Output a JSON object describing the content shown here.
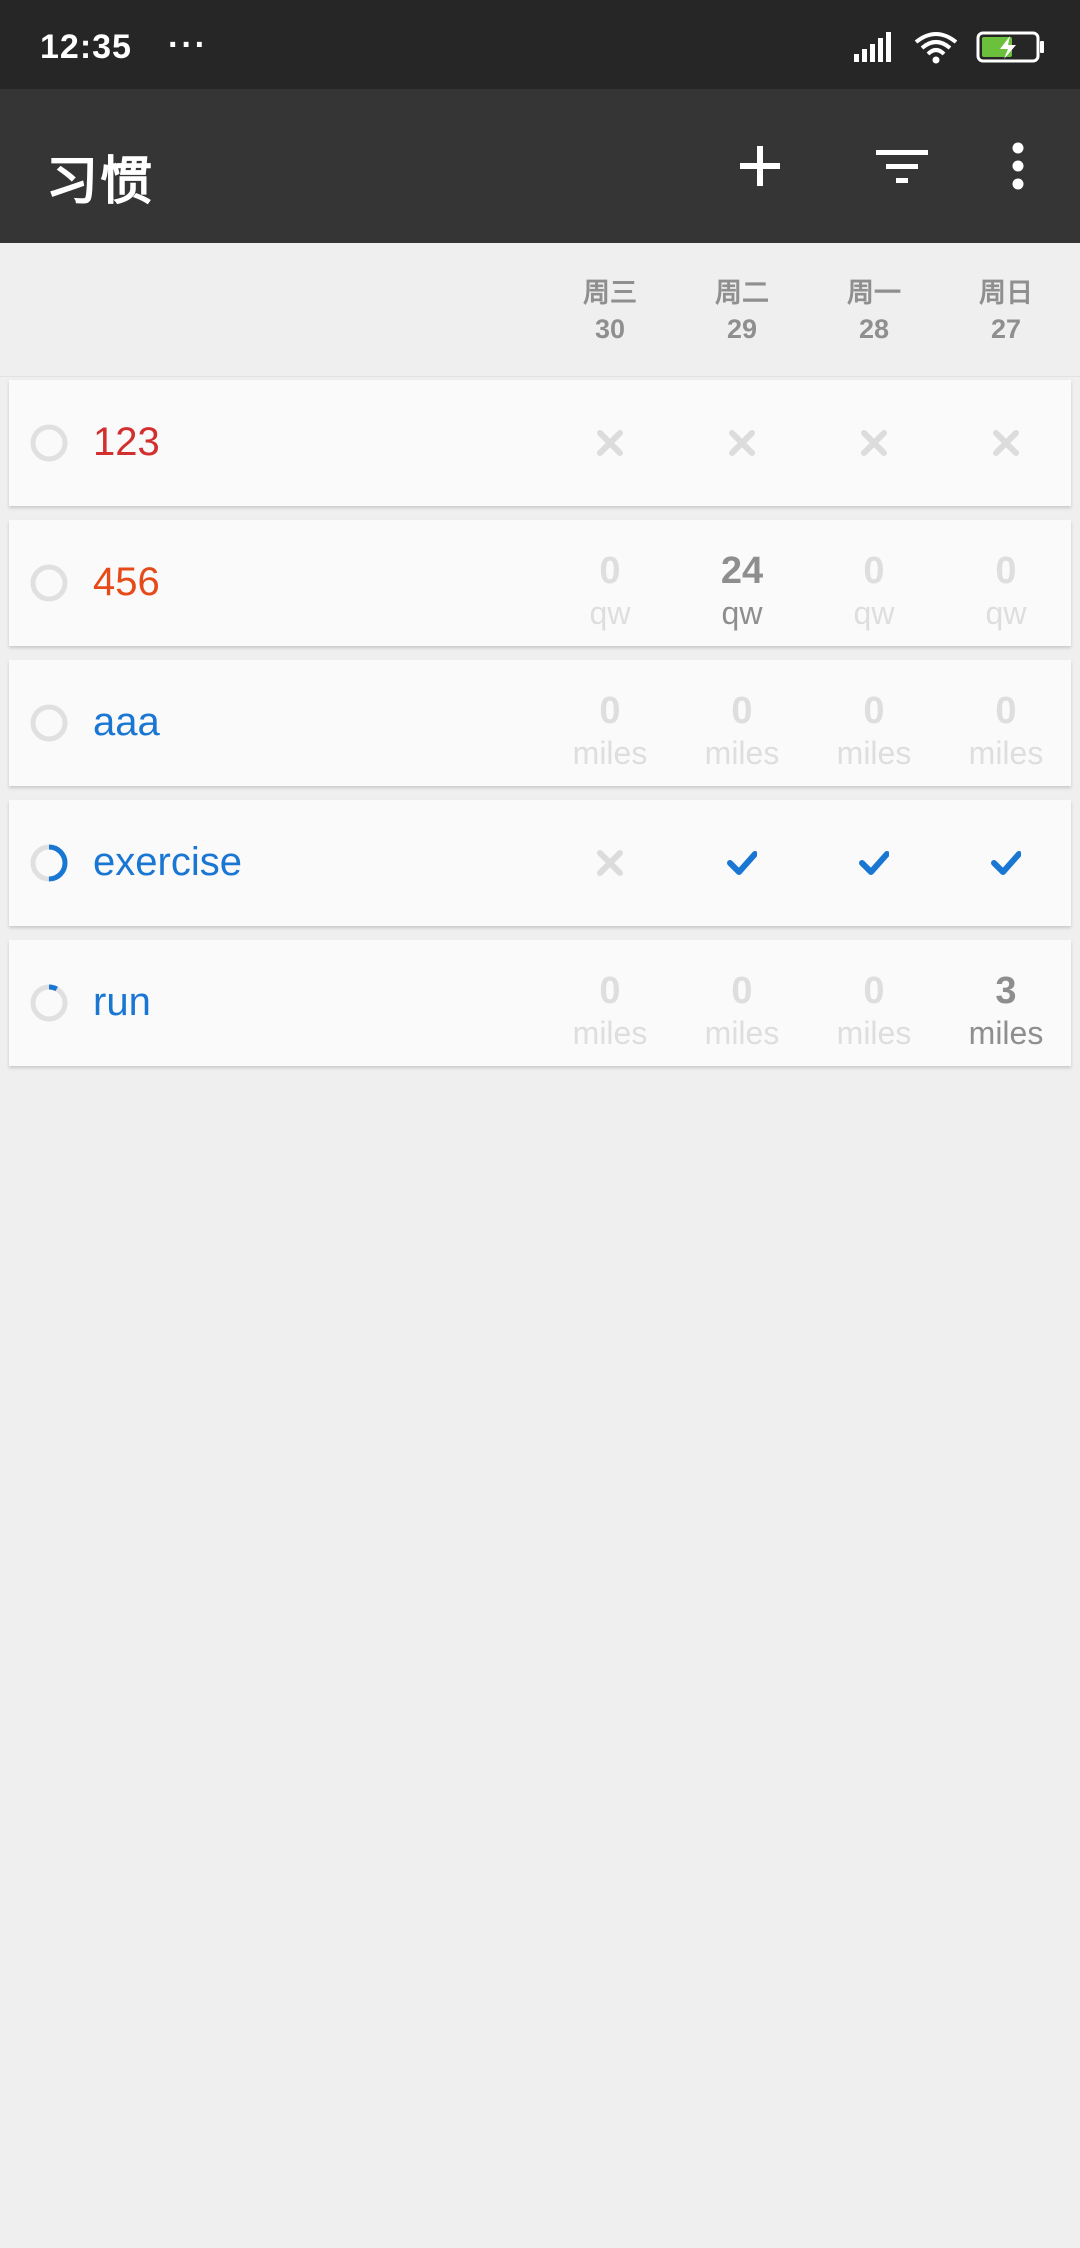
{
  "status_bar": {
    "time": "12:35",
    "dots": "···"
  },
  "app_bar": {
    "title": "习惯",
    "add_icon": "plus-icon",
    "filter_icon": "filter-icon",
    "menu_icon": "more-vert-icon"
  },
  "colors": {
    "app_bar": "#353535",
    "status_bar": "#262626",
    "red": "#d32f2f",
    "orange": "#e64a19",
    "blue": "#1976d2",
    "inactive": "#dedede",
    "active": "#8e8e8e",
    "check": "#1976d2"
  },
  "days": [
    {
      "weekday": "周三",
      "date": "30"
    },
    {
      "weekday": "周二",
      "date": "29"
    },
    {
      "weekday": "周一",
      "date": "28"
    },
    {
      "weekday": "周日",
      "date": "27"
    }
  ],
  "habits": [
    {
      "name": "123",
      "color": "#d32f2f",
      "progress": 0,
      "cells": [
        {
          "type": "cross"
        },
        {
          "type": "cross"
        },
        {
          "type": "cross"
        },
        {
          "type": "cross"
        }
      ]
    },
    {
      "name": "456",
      "color": "#e64a19",
      "progress": 0,
      "cells": [
        {
          "type": "value",
          "value": "0",
          "unit": "qw",
          "active": false
        },
        {
          "type": "value",
          "value": "24",
          "unit": "qw",
          "active": true
        },
        {
          "type": "value",
          "value": "0",
          "unit": "qw",
          "active": false
        },
        {
          "type": "value",
          "value": "0",
          "unit": "qw",
          "active": false
        }
      ]
    },
    {
      "name": "aaa",
      "color": "#1976d2",
      "progress": 0,
      "cells": [
        {
          "type": "value",
          "value": "0",
          "unit": "miles",
          "active": false
        },
        {
          "type": "value",
          "value": "0",
          "unit": "miles",
          "active": false
        },
        {
          "type": "value",
          "value": "0",
          "unit": "miles",
          "active": false
        },
        {
          "type": "value",
          "value": "0",
          "unit": "miles",
          "active": false
        }
      ]
    },
    {
      "name": "exercise",
      "color": "#1976d2",
      "progress": 0.5,
      "cells": [
        {
          "type": "cross"
        },
        {
          "type": "check"
        },
        {
          "type": "check"
        },
        {
          "type": "check"
        }
      ]
    },
    {
      "name": "run",
      "color": "#1976d2",
      "progress": 0.08,
      "cells": [
        {
          "type": "value",
          "value": "0",
          "unit": "miles",
          "active": false
        },
        {
          "type": "value",
          "value": "0",
          "unit": "miles",
          "active": false
        },
        {
          "type": "value",
          "value": "0",
          "unit": "miles",
          "active": false
        },
        {
          "type": "value",
          "value": "3",
          "unit": "miles",
          "active": true
        }
      ]
    }
  ]
}
